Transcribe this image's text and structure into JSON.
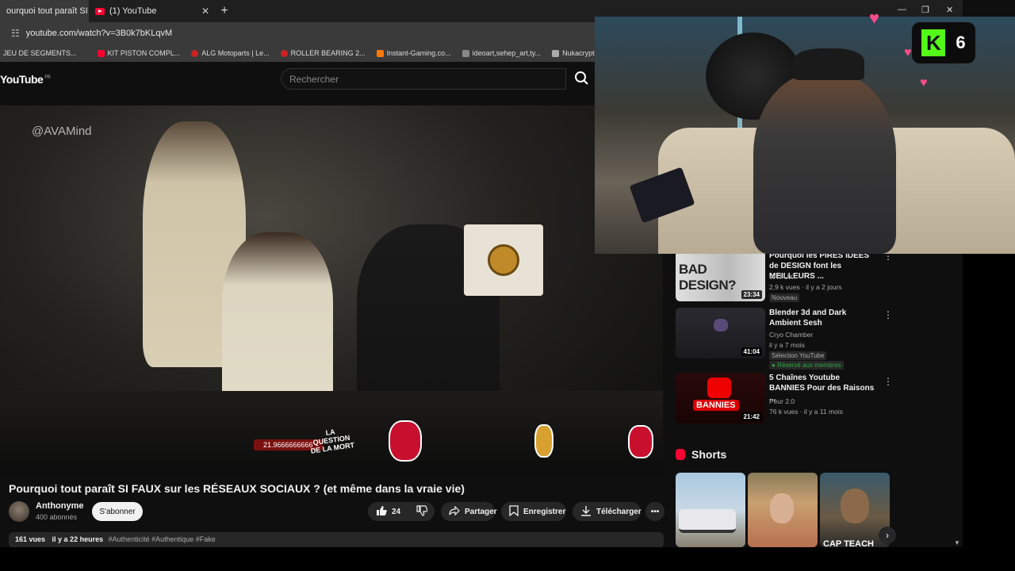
{
  "browser": {
    "tabs": [
      {
        "label": "ourquoi tout paraît SI F",
        "active": true
      },
      {
        "label": "(1) YouTube",
        "active": false
      }
    ],
    "new_tab": "+",
    "url": "youtube.com/watch?v=3B0k7bKLqvM",
    "bookmarks": [
      {
        "label": "JEU DE SEGMENTS...",
        "color": "#555555"
      },
      {
        "label": "KIT PISTON COMPL...",
        "color": "#ff0033"
      },
      {
        "label": "ALG Motoparts | Le...",
        "color": "#cc2222"
      },
      {
        "label": "ROLLER BEARING 2...",
        "color": "#cc2222"
      },
      {
        "label": "Instant-Gaming.co...",
        "color": "#ff7a00"
      },
      {
        "label": "ideoart,sehep_art,ty...",
        "color": "#888888"
      },
      {
        "label": "Nukacrypt - All Thin...",
        "color": "#aaaaaa"
      }
    ]
  },
  "youtube": {
    "logo": "YouTube",
    "logo_region": "FR",
    "search_placeholder": "Rechercher"
  },
  "video": {
    "watermark": "@AVAMind",
    "overlay_counter": "21.9666666666",
    "overlay_text": "LA QUESTION DE LA MORT",
    "title": "Pourquoi tout paraît SI FAUX sur les RÉSEAUX SOCIAUX ? (et même dans la vraie vie)",
    "channel": "Anthonyme",
    "subscribers": "400 abonnés",
    "subscribe_label": "S'abonner",
    "like_count": "24",
    "share_label": "Partager",
    "save_label": "Enregistrer",
    "download_label": "Télécharger",
    "views": "161 vues",
    "age": "il y a 22 heures",
    "hashtags": "#Authenticité #Authentique #Fake"
  },
  "stream": {
    "kick_logo": "K",
    "viewer_count": "6"
  },
  "recommendations": [
    {
      "title": "Pourquoi les PIRES IDÉES de DESIGN font les MEILLEURS ...",
      "thumb_text": "BAD DESIGN?",
      "channel": "WTFUX",
      "meta": "2,9 k vues · il y a 2 jours",
      "badge": "Nouveau",
      "badge2": "",
      "duration": "23:34"
    },
    {
      "title": "Blender 3d and Dark Ambient Sesh",
      "thumb_text": "",
      "channel": "Cryo Chamber",
      "meta": "il y a 7 mois",
      "badge": "Sélection YouTube",
      "badge2": "Réservé aux membres",
      "duration": "41:04"
    },
    {
      "title": "5 Chaînes Youtube BANNIES Pour des Raisons ...",
      "thumb_text": "BANNIES",
      "channel": "Peur 2.0",
      "meta": "76 k vues · il y a 11 mois",
      "badge": "",
      "badge2": "",
      "duration": "21:42"
    }
  ],
  "shorts": {
    "heading": "Shorts",
    "third_caption": "CAP TEACH"
  }
}
